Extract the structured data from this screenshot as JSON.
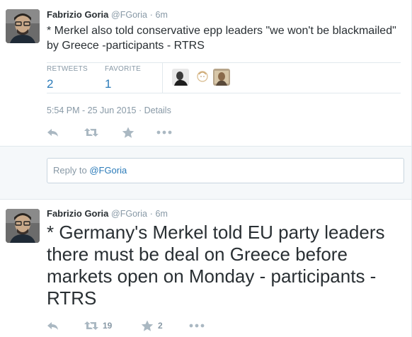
{
  "tweets": [
    {
      "fullname": "Fabrizio Goria",
      "username": "@FGoria",
      "separator": "·",
      "time": "6m",
      "text": "* Merkel also told conservative epp leaders \"we won't be blackmailed\" by Greece -participants - RTRS",
      "stats": {
        "retweets_label": "RETWEETS",
        "retweets_value": "2",
        "favorites_label": "FAVORITE",
        "favorites_value": "1"
      },
      "timestamp": "5:54 PM - 25 Jun 2015",
      "meta_separator": "·",
      "details_label": "Details",
      "actions": {
        "reply_icon": "reply-icon",
        "retweet_icon": "retweet-icon",
        "favorite_icon": "star-icon",
        "more_icon": "more-icon"
      }
    },
    {
      "fullname": "Fabrizio Goria",
      "username": "@FGoria",
      "separator": "·",
      "time": "6m",
      "text": "* Germany's Merkel told EU party leaders there must be deal on Greece before markets open on Monday - participants - RTRS",
      "actions": {
        "retweet_count": "19",
        "favorite_count": "2"
      }
    }
  ],
  "reply": {
    "prefix": "Reply to ",
    "mention": "@FGoria"
  },
  "colors": {
    "link": "#2b7bb9",
    "muted": "#8899a6",
    "icon": "#aab8c2",
    "border": "#e1e8ed",
    "reply_bg": "#f5f8fa"
  }
}
